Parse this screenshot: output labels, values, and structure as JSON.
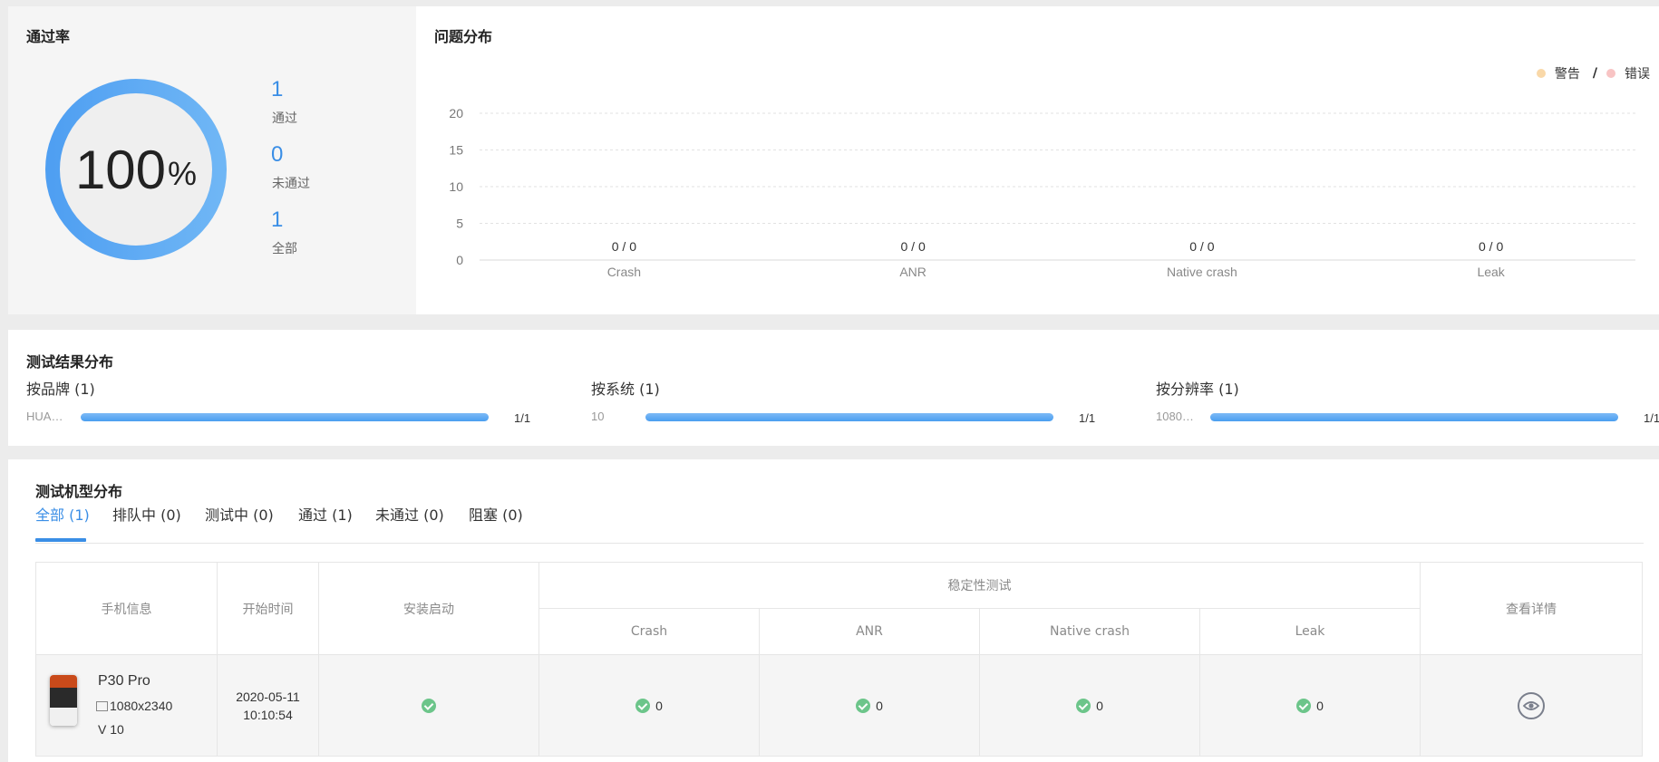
{
  "pass_rate": {
    "title": "通过率",
    "percent_value": "100",
    "percent_sign": "%",
    "rate": 1.0,
    "stats": [
      {
        "value": "1",
        "label": "通过"
      },
      {
        "value": "0",
        "label": "未通过"
      },
      {
        "value": "1",
        "label": "全部"
      }
    ]
  },
  "issue_distribution": {
    "title": "问题分布",
    "legend": [
      {
        "label": "警告",
        "color": "#f9d8a8"
      },
      {
        "label": "错误",
        "color": "#f8c4c4"
      }
    ],
    "legend_separator": "/"
  },
  "chart_data": {
    "type": "bar",
    "categories": [
      "Crash",
      "ANR",
      "Native crash",
      "Leak"
    ],
    "series": [
      {
        "name": "警告",
        "values": [
          0,
          0,
          0,
          0
        ]
      },
      {
        "name": "错误",
        "values": [
          0,
          0,
          0,
          0
        ]
      }
    ],
    "data_labels": [
      "0 / 0",
      "0 / 0",
      "0 / 0",
      "0 / 0"
    ],
    "yticks": [
      "0",
      "5",
      "10",
      "15",
      "20"
    ],
    "ylim": [
      0,
      20
    ],
    "grid": true,
    "legend_position": "top-right"
  },
  "result_distribution": {
    "title": "测试结果分布",
    "groups": [
      {
        "label": "按品牌 (1)",
        "category": "HUA…",
        "fraction": "1/1",
        "ratio": 1.0
      },
      {
        "label": "按系统 (1)",
        "category": "10",
        "fraction": "1/1",
        "ratio": 1.0
      },
      {
        "label": "按分辨率 (1)",
        "category": "1080…",
        "fraction": "1/1",
        "ratio": 1.0
      }
    ]
  },
  "device_distribution": {
    "title": "测试机型分布",
    "tabs": [
      {
        "label": "全部 (1)",
        "active": true
      },
      {
        "label": "排队中 (0)"
      },
      {
        "label": "测试中 (0)"
      },
      {
        "label": "通过 (1)"
      },
      {
        "label": "未通过 (0)"
      },
      {
        "label": "阻塞 (0)"
      }
    ],
    "table": {
      "headers": {
        "phone_info": "手机信息",
        "start_time": "开始时间",
        "install": "安装启动",
        "stability": "稳定性测试",
        "crash": "Crash",
        "anr": "ANR",
        "native_crash": "Native crash",
        "leak": "Leak",
        "details": "查看详情"
      },
      "rows": [
        {
          "model": "P30 Pro",
          "resolution": "1080x2340",
          "version": "V 10",
          "start_date": "2020-05-11",
          "start_time": "10:10:54",
          "crash": "0",
          "anr": "0",
          "native_crash": "0",
          "leak": "0"
        }
      ]
    }
  },
  "colors": {
    "accent": "#3a8ee6",
    "success": "#6cc58a",
    "bar": "#4a9ef0"
  }
}
